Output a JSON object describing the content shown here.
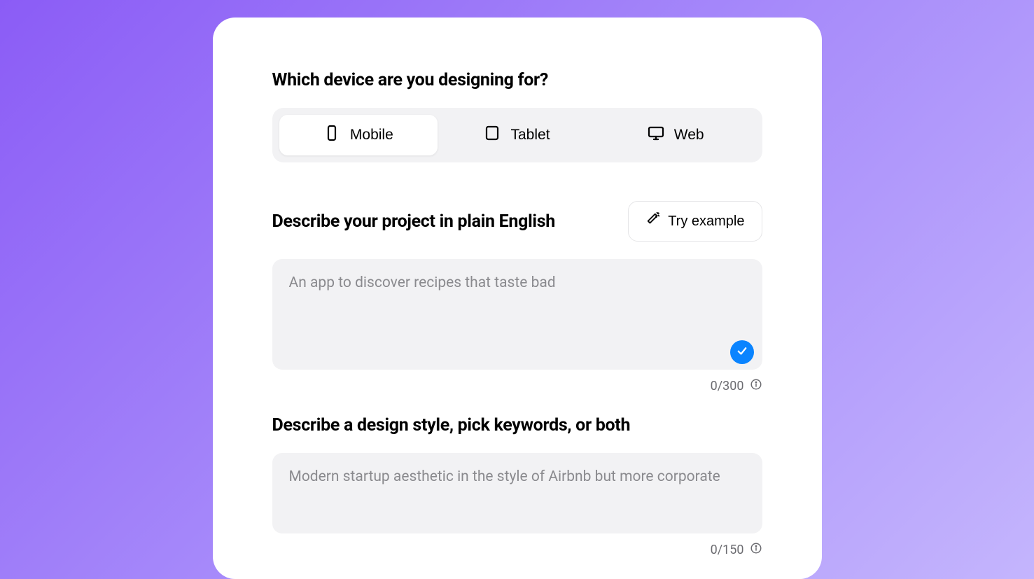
{
  "device_section": {
    "heading": "Which device are you designing for?",
    "options": {
      "mobile": "Mobile",
      "tablet": "Tablet",
      "web": "Web"
    }
  },
  "project_section": {
    "heading": "Describe your project in plain English",
    "try_example_label": "Try example",
    "placeholder": "An app to discover recipes that taste bad",
    "value": "",
    "counter": "0/300"
  },
  "style_section": {
    "heading": "Describe a design style, pick keywords, or both",
    "placeholder": "Modern startup aesthetic in the style of Airbnb but more corporate",
    "value": "",
    "counter": "0/150"
  }
}
